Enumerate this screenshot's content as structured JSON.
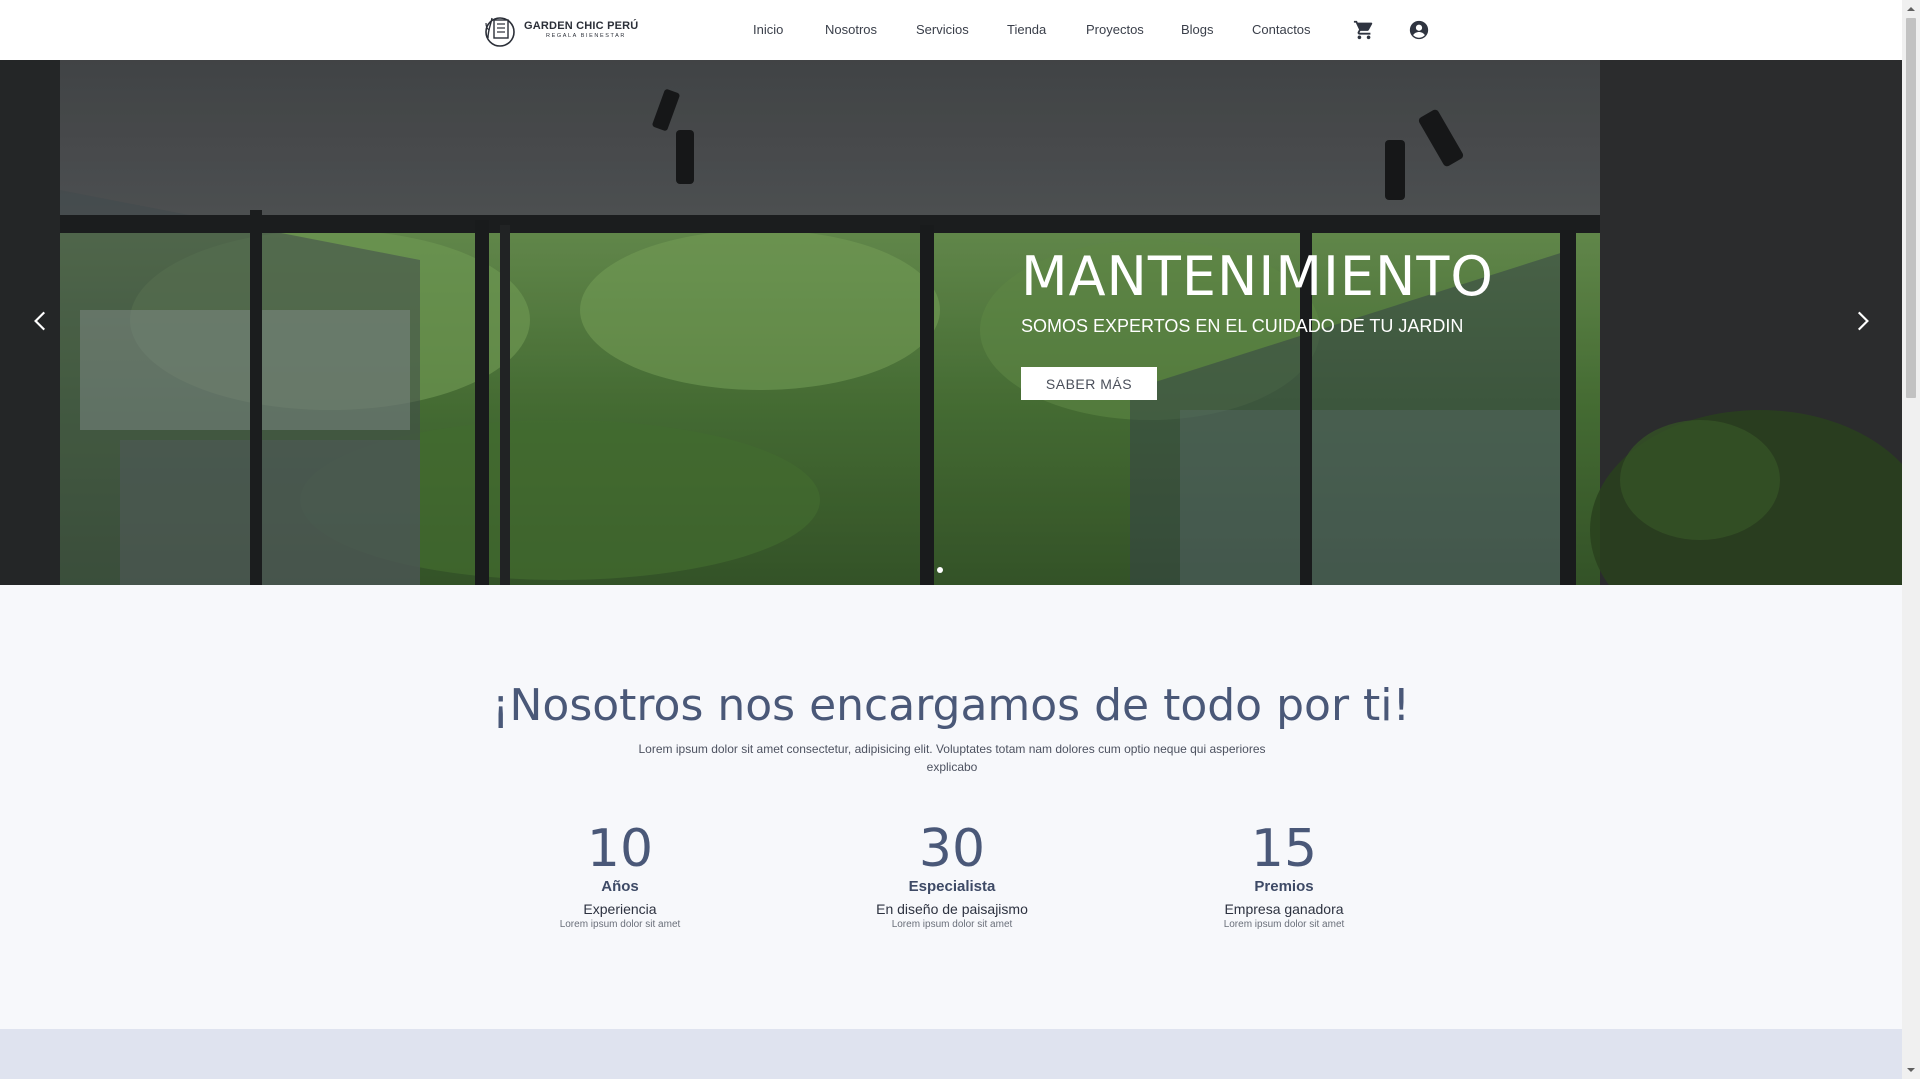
{
  "brand": {
    "name": "GARDEN CHIC PERÚ",
    "tagline": "REGALA BIENESTAR"
  },
  "nav": {
    "items": [
      "Inicio",
      "Nosotros",
      "Servicios",
      "Tienda",
      "Proyectos",
      "Blogs",
      "Contactos"
    ],
    "cart_icon": "cart-icon",
    "account_icon": "account-circle-icon"
  },
  "hero": {
    "title": "MANTENIMIENTO",
    "subtitle": "SOMOS EXPERTOS EN EL CUIDADO DE TU JARDIN",
    "button": "SABER MÁS",
    "prev_icon": "chevron-left-icon",
    "next_icon": "chevron-right-icon",
    "slide_count": 1,
    "active_slide": 1
  },
  "section": {
    "headline": "¡Nosotros nos encargamos de todo por ti!",
    "lead": "Lorem ipsum dolor sit amet consectetur, adipisicing elit. Voluptates totam nam dolores cum optio neque qui asperiores explicabo",
    "stats": [
      {
        "number": "10",
        "label": "Años",
        "desc": "Experiencia",
        "note": "Lorem ipsum dolor sit amet"
      },
      {
        "number": "30",
        "label": "Especialista",
        "desc": "En diseño de paisajismo",
        "note": "Lorem ipsum dolor sit amet"
      },
      {
        "number": "15",
        "label": "Premios",
        "desc": "Empresa ganadora",
        "note": "Lorem ipsum dolor sit amet"
      }
    ]
  },
  "colors": {
    "accent": "#4a5878",
    "background": "#f7f8fb",
    "band": "#dfe3ef"
  }
}
